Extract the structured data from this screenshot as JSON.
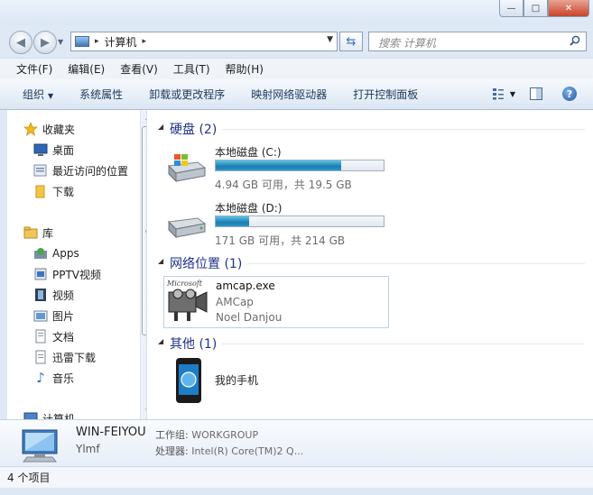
{
  "window": {
    "minimize_glyph": "—",
    "maximize_glyph": "□",
    "close_glyph": "✕"
  },
  "navigation": {
    "back_glyph": "◀",
    "forward_glyph": "▶",
    "address": "计算机",
    "address_separator": "▸",
    "search_placeholder": "搜索 计算机"
  },
  "menu": [
    "文件(F)",
    "编辑(E)",
    "查看(V)",
    "工具(T)",
    "帮助(H)"
  ],
  "toolbar": {
    "organize": "组织",
    "system_properties": "系统属性",
    "uninstall": "卸载或更改程序",
    "map_drive": "映射网络驱动器",
    "control_panel": "打开控制面板",
    "help_glyph": "?"
  },
  "nav_pane": {
    "favorites": "收藏夹",
    "desktop": "桌面",
    "recent": "最近访问的位置",
    "downloads": "下载",
    "libraries": "库",
    "apps": "Apps",
    "pptv": "PPTV视频",
    "video": "视频",
    "pictures": "图片",
    "documents": "文档",
    "thunder": "迅雷下载",
    "music": "音乐",
    "computer": "计算机"
  },
  "content": {
    "hard_disks_header": "硬盘 (2)",
    "drives": [
      {
        "name": "本地磁盘 (C:)",
        "info": "4.94 GB 可用，共 19.5 GB",
        "used_fraction": 0.747
      },
      {
        "name": "本地磁盘 (D:)",
        "info": "171 GB 可用，共 214 GB",
        "used_fraction": 0.2
      }
    ],
    "network_header": "网络位置 (1)",
    "network_item": {
      "filename": "amcap.exe",
      "description": "AMCap",
      "company": "Noel Danjou",
      "icon_caption": "Microsoft"
    },
    "other_header": "其他 (1)",
    "other_item": "我的手机"
  },
  "details": {
    "name": "WIN-FEIYOU",
    "sub": "Ylmf",
    "workgroup_label": "工作组:",
    "workgroup_value": "WORKGROUP",
    "processor_label": "处理器:",
    "processor_value": "Intel(R) Core(TM)2 Q..."
  },
  "status": {
    "item_count": "4 个项目"
  },
  "colors": {
    "group_header": "#1e3287",
    "drive_fill": "#2a94c7",
    "accent_border": "#b8d1ea"
  }
}
